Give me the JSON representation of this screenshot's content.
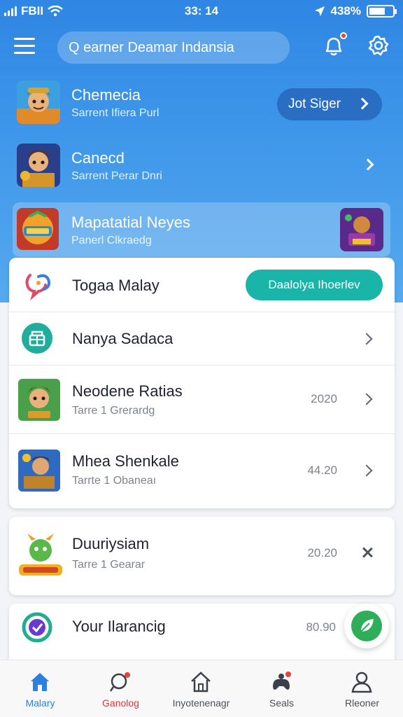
{
  "status_bar": {
    "carrier": "FBII",
    "time": "33: 14",
    "battery": "438%"
  },
  "header": {
    "search_placeholder": "Q earner Deamar Indansia",
    "icons": [
      "menu-icon",
      "bell-icon",
      "gear-icon"
    ]
  },
  "featured": [
    {
      "title": "Chemecia",
      "subtitle": "Sarrent Ifiera Purl",
      "action": "Jot Siger"
    },
    {
      "title": "Canecd",
      "subtitle": "Sarrent Perar Dnri"
    },
    {
      "title": "Mapatatial Neyes",
      "subtitle": "Panerl Clkraedg"
    }
  ],
  "list_card": [
    {
      "title": "Togaa Malay",
      "action": "Daalolya Ihoerlev",
      "icon": "chat-bubble-icon"
    },
    {
      "title": "Nanya Sadaca",
      "icon": "shopping-basket-icon"
    },
    {
      "title": "Neodene Ratias",
      "subtitle": "Tarre 1 Grerardg",
      "value": "2020"
    },
    {
      "title": "Mhea Shenkale",
      "subtitle": "Tarrte 1 Obaneaı",
      "value": "44.20"
    }
  ],
  "card2": {
    "title": "Duuriysiam",
    "subtitle": "Tarre 1 Gearar",
    "value": "20.20"
  },
  "card3": {
    "title": "Your Ilarancig",
    "value": "80.90"
  },
  "bottom_nav": [
    {
      "label": "Malary",
      "icon": "home-icon",
      "active": true
    },
    {
      "label": "Ganolog",
      "icon": "search-icon"
    },
    {
      "label": "Inyotenenagr",
      "icon": "house-icon"
    },
    {
      "label": "Seals",
      "icon": "gamepad-icon"
    },
    {
      "label": "Rleoner",
      "icon": "profile-icon"
    }
  ],
  "colors": {
    "primary": "#2f86e3",
    "teal": "#19b5a8",
    "badge": "#e9403d",
    "fab_green": "#2fae5a"
  }
}
